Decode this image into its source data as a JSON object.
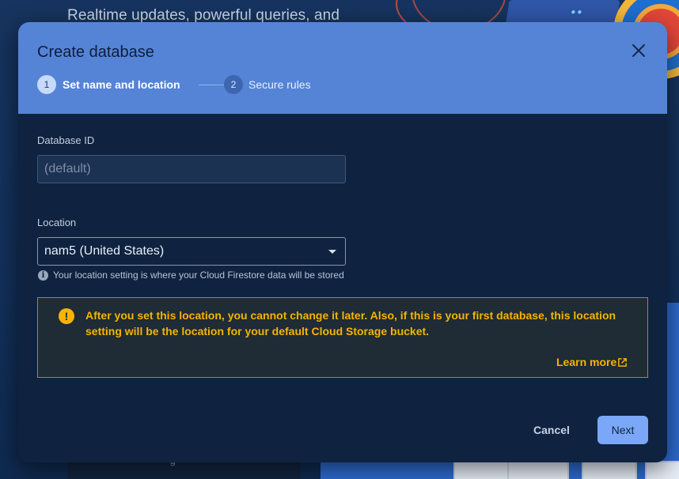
{
  "background": {
    "hero_text": "Realtime updates, powerful queries, and",
    "card_text": "g"
  },
  "dialog": {
    "title": "Create database",
    "close_icon": "close-icon",
    "steps": [
      {
        "number": "1",
        "label": "Set name and location"
      },
      {
        "number": "2",
        "label": "Secure rules"
      }
    ],
    "database_id": {
      "label": "Database ID",
      "value": "",
      "placeholder": "(default)"
    },
    "location": {
      "label": "Location",
      "selected": "nam5 (United States)",
      "hint": "Your location setting is where your Cloud Firestore data will be stored"
    },
    "warning": {
      "text": "After you set this location, you cannot change it later. Also, if this is your first database, this location setting will be the location for your default Cloud Storage bucket.",
      "learn_more": "Learn more",
      "color": "#f5b400"
    },
    "buttons": {
      "cancel": "Cancel",
      "next": "Next"
    }
  },
  "colors": {
    "header": "#5584d6",
    "dialog_bg": "#0f2340",
    "primary_button": "#7aa7f7"
  }
}
